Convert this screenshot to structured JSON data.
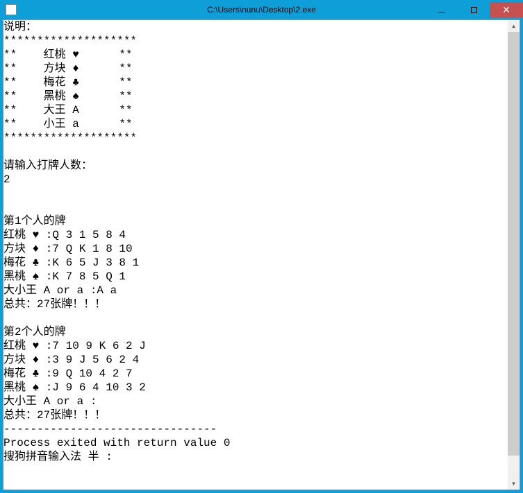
{
  "window": {
    "title": "C:\\Users\\nunu\\Desktop\\2.exe"
  },
  "console": {
    "lines": [
      "说明：",
      "********************",
      "**    红桃 ♥      **",
      "**    方块 ♦      **",
      "**    梅花 ♣      **",
      "**    黑桃 ♠      **",
      "**    大王 A      **",
      "**    小王 a      **",
      "********************",
      "",
      "请输入打牌人数：",
      "2",
      "",
      "",
      "第1个人的牌",
      "红桃 ♥ :Q 3 1 5 8 4",
      "方块 ♦ :7 Q K 1 8 10",
      "梅花 ♣ :K 6 5 J 3 8 1",
      "黑桃 ♠ :K 7 8 5 Q 1",
      "大小王 A or a :A a",
      "总共：27张牌！！！",
      "",
      "第2个人的牌",
      "红桃 ♥ :7 10 9 K 6 2 J",
      "方块 ♦ :3 9 J 5 6 2 4",
      "梅花 ♣ :9 Q 10 4 2 7",
      "黑桃 ♠ :J 9 6 4 10 3 2",
      "大小王 A or a :",
      "总共：27张牌！！！",
      "--------------------------------",
      "Process exited with return value 0",
      "搜狗拼音输入法 半 :"
    ]
  }
}
